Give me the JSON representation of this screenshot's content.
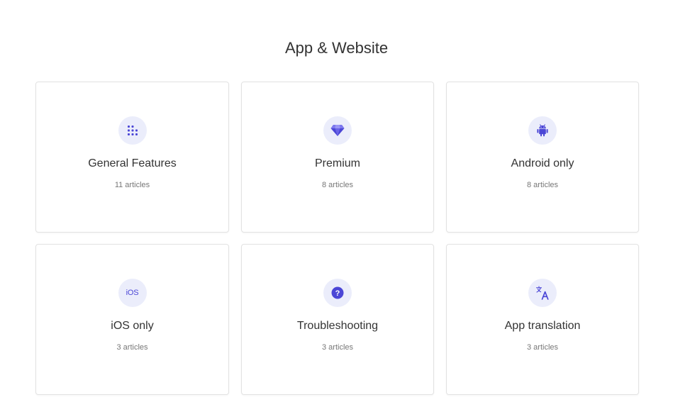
{
  "section": {
    "title": "App & Website"
  },
  "colors": {
    "accent": "#4b46d6",
    "icon_bg": "#ebedfb",
    "card_border": "#e2e2e2"
  },
  "categories": [
    {
      "title": "General Features",
      "count": "11 articles",
      "icon": "grid-dots-icon"
    },
    {
      "title": "Premium",
      "count": "8 articles",
      "icon": "diamond-icon"
    },
    {
      "title": "Android only",
      "count": "8 articles",
      "icon": "android-icon"
    },
    {
      "title": "iOS only",
      "count": "3 articles",
      "icon": "ios-icon",
      "icon_text": "iOS"
    },
    {
      "title": "Troubleshooting",
      "count": "3 articles",
      "icon": "question-icon",
      "icon_text": "?"
    },
    {
      "title": "App translation",
      "count": "3 articles",
      "icon": "translate-icon"
    }
  ]
}
